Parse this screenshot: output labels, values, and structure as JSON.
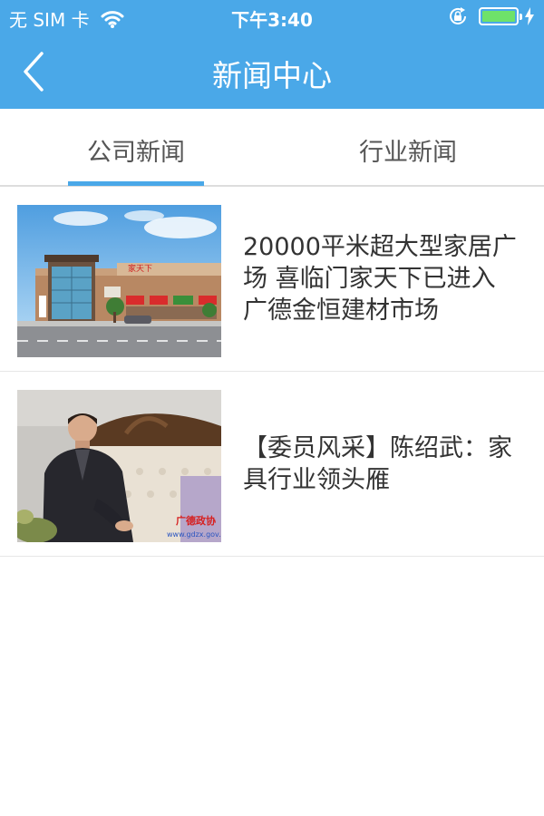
{
  "status": {
    "carrier": "无 SIM 卡",
    "time": "下午3:40",
    "battery_level": 1.0
  },
  "nav": {
    "title": "新闻中心"
  },
  "tabs": [
    {
      "label": "公司新闻",
      "active": true
    },
    {
      "label": "行业新闻",
      "active": false
    }
  ],
  "news": [
    {
      "title": "20000平米超大型家居广场 喜临门家天下已进入广德金恒建材市场",
      "sign_text": "家天下"
    },
    {
      "title": "【委员风采】陈绍武：家具行业领头雁",
      "watermark": "广德政协",
      "watermark_url": "www.gdzx.gov.cn"
    }
  ],
  "colors": {
    "accent": "#4aa8e8",
    "battery": "#6ee26a",
    "text": "#333333"
  }
}
